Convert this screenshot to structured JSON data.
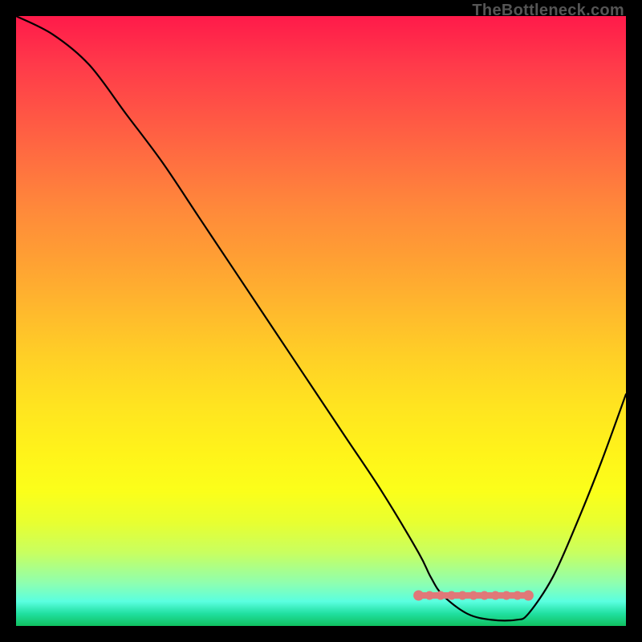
{
  "attribution": "TheBottleneck.com",
  "colors": {
    "background": "#000000",
    "curve_stroke": "#000000",
    "highlight_stroke": "#e07878",
    "gradient_top": "#ff1a4a",
    "gradient_bottom": "#10c060"
  },
  "chart_data": {
    "type": "line",
    "title": "",
    "xlabel": "",
    "ylabel": "",
    "xlim": [
      0,
      100
    ],
    "ylim": [
      0,
      100
    ],
    "grid": false,
    "series": [
      {
        "name": "bottleneck-curve",
        "x": [
          0,
          6,
          12,
          18,
          24,
          30,
          36,
          42,
          48,
          54,
          60,
          66,
          68,
          70,
          74,
          78,
          82,
          84,
          88,
          92,
          96,
          100
        ],
        "values": [
          100,
          97,
          92,
          84,
          76,
          67,
          58,
          49,
          40,
          31,
          22,
          12,
          8,
          5,
          2,
          1,
          1,
          2,
          8,
          17,
          27,
          38
        ]
      }
    ],
    "annotations": [
      {
        "name": "minimum-highlight",
        "type": "segment",
        "style": "dotted-thick",
        "x": [
          66,
          84
        ],
        "values": [
          5,
          5
        ]
      }
    ]
  }
}
